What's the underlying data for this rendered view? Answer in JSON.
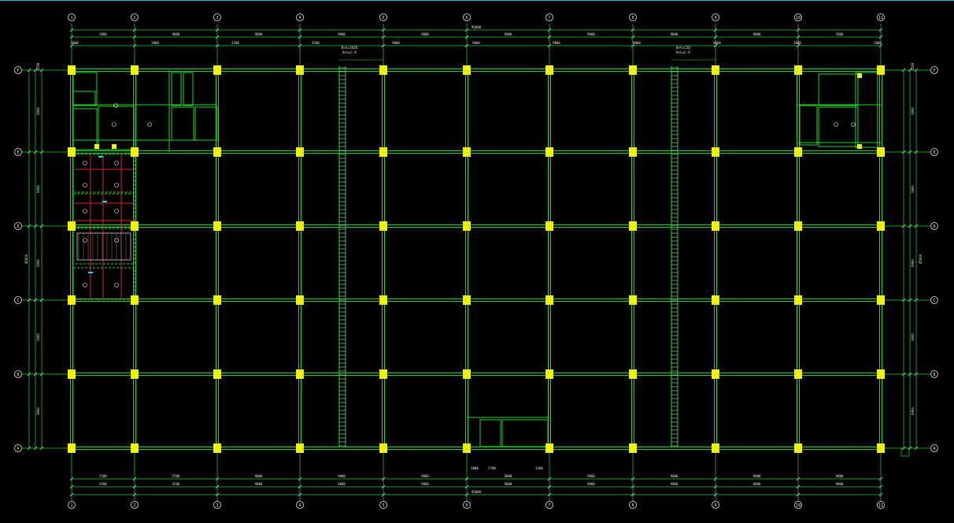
{
  "drawing": {
    "column_axes": [
      "1",
      "2",
      "3",
      "4",
      "5",
      "6",
      "7",
      "8",
      "9",
      "10",
      "11"
    ],
    "row_axes": [
      "F",
      "E",
      "D",
      "C",
      "B",
      "A"
    ],
    "top_dims_row1": [
      "5000",
      "9000",
      "9000",
      "9000",
      "9000",
      "9000",
      "9000",
      "9000",
      "9000",
      "5000"
    ],
    "top_total": "96000",
    "top_dims_row2": [
      "3000",
      "2000",
      "4500",
      "4500",
      "9000",
      "9000",
      "9000",
      "9000",
      "9000",
      "3000",
      "2000"
    ],
    "bottom_dims_row1": [
      "2500",
      "2500",
      "9000",
      "9000",
      "9000",
      "9000",
      "9000",
      "9000",
      "9000",
      "9000"
    ],
    "bottom_total": "96000",
    "bottom_dims_row2": [
      "4500",
      "4500",
      "9000",
      "9000",
      "9000",
      "9000",
      "9000",
      "9000",
      "9000",
      "9000"
    ],
    "bottom_detail_dims": [
      "3000",
      "2700",
      "3300"
    ],
    "left_dims": [
      "2500",
      "9000",
      "9000",
      "9000",
      "9000",
      "9000"
    ],
    "left_total": "45000",
    "right_dims": [
      "2500",
      "9000",
      "9000",
      "9000",
      "9000",
      "9000"
    ],
    "right_total": "45000",
    "stair_note_left": "B×h=1A20",
    "stair_note_left_sub": "B×h=C-8",
    "stair_note_right": "B×h=C20",
    "stair_note_right_sub": "B×h=C-8"
  },
  "colors": {
    "grid": "#1fd62a",
    "column": "#f4f400",
    "dimension": "#e8e8e8",
    "axis_bubble": "#e8e8e8",
    "accent": "#e02020",
    "frame": "#2ab7c9"
  }
}
